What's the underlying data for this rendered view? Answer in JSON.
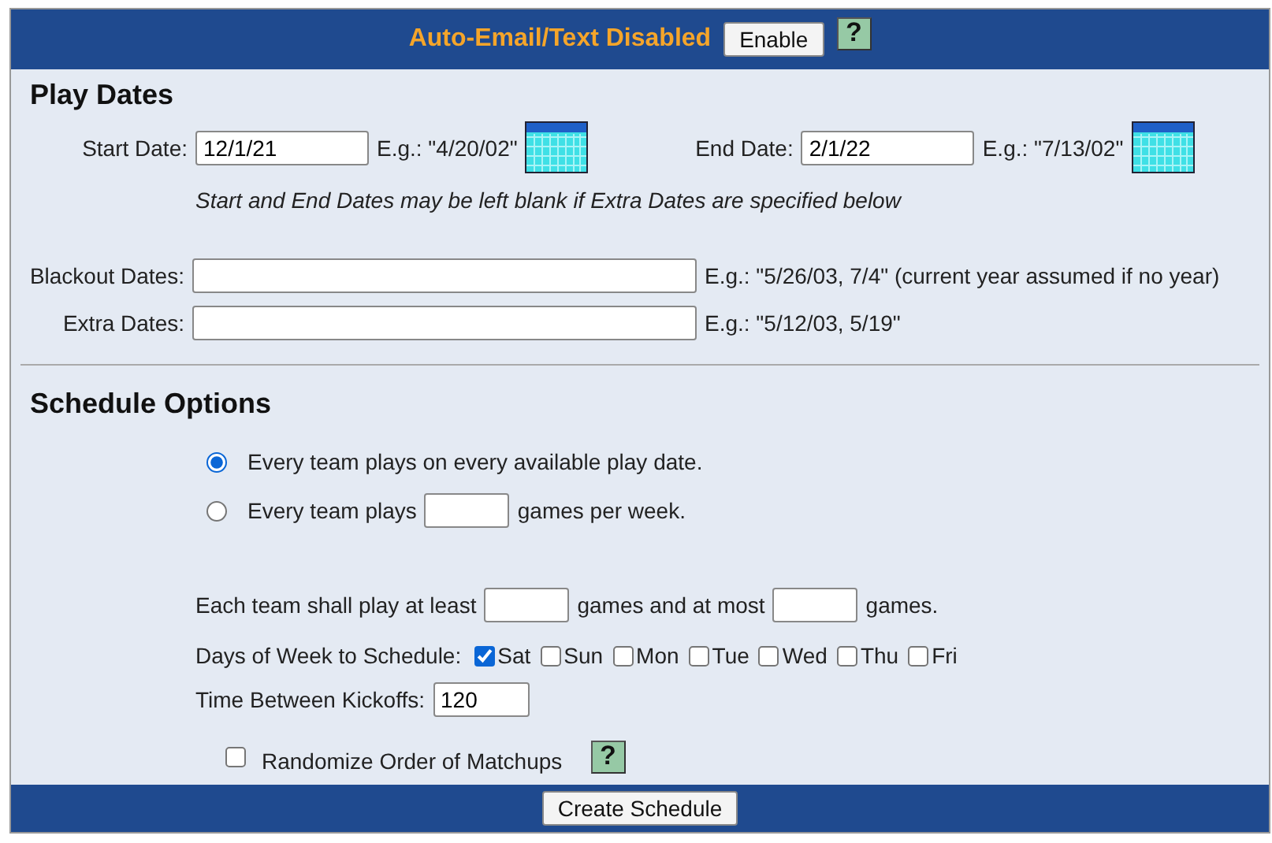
{
  "header": {
    "status": "Auto-Email/Text Disabled",
    "button": "Enable",
    "help": "?"
  },
  "play_dates": {
    "title": "Play Dates",
    "start": {
      "label": "Start Date:",
      "value": "12/1/21",
      "example": "E.g.: \"4/20/02\""
    },
    "end": {
      "label": "End Date:",
      "value": "2/1/22",
      "example": "E.g.: \"7/13/02\""
    },
    "note": "Start and End Dates may be left blank if Extra Dates are specified below",
    "blackout": {
      "label": "Blackout Dates:",
      "example": "E.g.: \"5/26/03, 7/4\" (current year assumed if no year)"
    },
    "extra": {
      "label": "Extra Dates:",
      "example": "E.g.: \"5/12/03, 5/19\""
    }
  },
  "schedule_options": {
    "title": "Schedule Options",
    "modes": [
      {
        "label": "Every team plays on every available play date.",
        "selected": true
      },
      {
        "label": "Every team plays",
        "suffix": "games per week.",
        "selected": false
      }
    ],
    "limits": {
      "prefix": "Each team shall play at least",
      "middle": "games and at most",
      "suffix": "games."
    },
    "days_label": "Days of Week to Schedule:",
    "days": [
      {
        "label": "Sat",
        "checked": true
      },
      {
        "label": "Sun",
        "checked": false
      },
      {
        "label": "Mon",
        "checked": false
      },
      {
        "label": "Tue",
        "checked": false
      },
      {
        "label": "Wed",
        "checked": false
      },
      {
        "label": "Thu",
        "checked": false
      },
      {
        "label": "Fri",
        "checked": false
      }
    ],
    "kickoff": {
      "label": "Time Between Kickoffs:",
      "value": "120"
    },
    "randomize": {
      "label": "Randomize Order of Matchups",
      "checked": false,
      "help": "?"
    }
  },
  "footer": {
    "button": "Create Schedule"
  }
}
